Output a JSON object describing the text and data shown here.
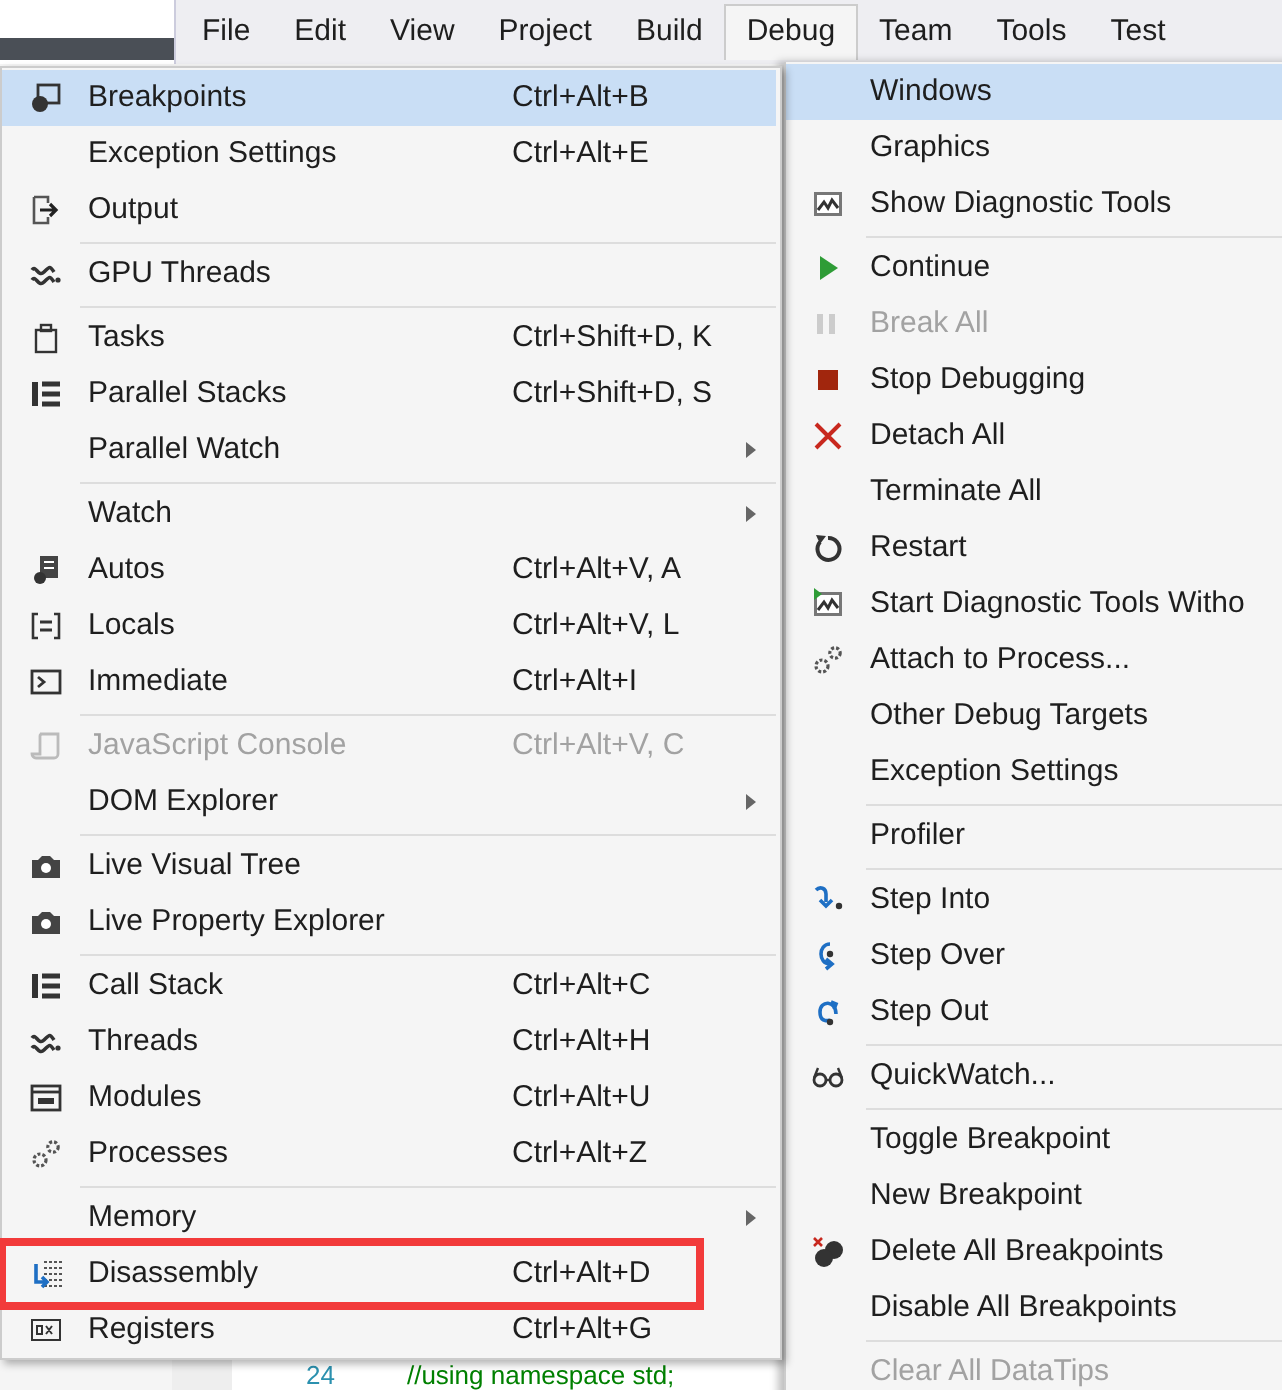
{
  "menu_bar": [
    {
      "label": "File",
      "selected": false
    },
    {
      "label": "Edit",
      "selected": false
    },
    {
      "label": "View",
      "selected": false
    },
    {
      "label": "Project",
      "selected": false
    },
    {
      "label": "Build",
      "selected": false
    },
    {
      "label": "Debug",
      "selected": true
    },
    {
      "label": "Team",
      "selected": false
    },
    {
      "label": "Tools",
      "selected": false
    },
    {
      "label": "Test",
      "selected": false
    }
  ],
  "windows_submenu": {
    "groups": [
      [
        {
          "label": "Breakpoints",
          "shortcut": "Ctrl+Alt+B",
          "selected": true,
          "disabled": false,
          "submenu": false,
          "highlighted": false
        },
        {
          "label": "Exception Settings",
          "shortcut": "Ctrl+Alt+E",
          "selected": false,
          "disabled": false,
          "submenu": false,
          "highlighted": false
        },
        {
          "label": "Output",
          "selected": false,
          "disabled": false,
          "submenu": false,
          "highlighted": false
        }
      ],
      [
        {
          "label": "GPU Threads",
          "selected": false,
          "disabled": false,
          "submenu": false,
          "highlighted": false
        }
      ],
      [
        {
          "label": "Tasks",
          "shortcut": "Ctrl+Shift+D, K",
          "selected": false,
          "disabled": false,
          "submenu": false,
          "highlighted": false
        },
        {
          "label": "Parallel Stacks",
          "shortcut": "Ctrl+Shift+D, S",
          "selected": false,
          "disabled": false,
          "submenu": false,
          "highlighted": false
        },
        {
          "label": "Parallel Watch",
          "selected": false,
          "disabled": false,
          "submenu": true,
          "highlighted": false
        }
      ],
      [
        {
          "label": "Watch",
          "selected": false,
          "disabled": false,
          "submenu": true,
          "highlighted": false
        },
        {
          "label": "Autos",
          "shortcut": "Ctrl+Alt+V, A",
          "selected": false,
          "disabled": false,
          "submenu": false,
          "highlighted": false
        },
        {
          "label": "Locals",
          "shortcut": "Ctrl+Alt+V, L",
          "selected": false,
          "disabled": false,
          "submenu": false,
          "highlighted": false
        },
        {
          "label": "Immediate",
          "shortcut": "Ctrl+Alt+I",
          "selected": false,
          "disabled": false,
          "submenu": false,
          "highlighted": false
        }
      ],
      [
        {
          "label": "JavaScript Console",
          "shortcut": "Ctrl+Alt+V, C",
          "selected": false,
          "disabled": true,
          "submenu": false,
          "highlighted": false
        },
        {
          "label": "DOM Explorer",
          "selected": false,
          "disabled": false,
          "submenu": true,
          "highlighted": false
        }
      ],
      [
        {
          "label": "Live Visual Tree",
          "selected": false,
          "disabled": false,
          "submenu": false,
          "highlighted": false
        },
        {
          "label": "Live Property Explorer",
          "selected": false,
          "disabled": false,
          "submenu": false,
          "highlighted": false
        }
      ],
      [
        {
          "label": "Call Stack",
          "shortcut": "Ctrl+Alt+C",
          "selected": false,
          "disabled": false,
          "submenu": false,
          "highlighted": false
        },
        {
          "label": "Threads",
          "shortcut": "Ctrl+Alt+H",
          "selected": false,
          "disabled": false,
          "submenu": false,
          "highlighted": false
        },
        {
          "label": "Modules",
          "shortcut": "Ctrl+Alt+U",
          "selected": false,
          "disabled": false,
          "submenu": false,
          "highlighted": false
        },
        {
          "label": "Processes",
          "shortcut": "Ctrl+Alt+Z",
          "selected": false,
          "disabled": false,
          "submenu": false,
          "highlighted": false
        }
      ],
      [
        {
          "label": "Memory",
          "selected": false,
          "disabled": false,
          "submenu": true,
          "highlighted": false
        },
        {
          "label": "Disassembly",
          "shortcut": "Ctrl+Alt+D",
          "selected": false,
          "disabled": false,
          "submenu": false,
          "highlighted": true
        },
        {
          "label": "Registers",
          "shortcut": "Ctrl+Alt+G",
          "selected": false,
          "disabled": false,
          "submenu": false,
          "highlighted": false
        }
      ]
    ]
  },
  "debug_menu": {
    "groups": [
      [
        {
          "label": "Windows",
          "selected": true,
          "disabled": false
        },
        {
          "label": "Graphics",
          "selected": false,
          "disabled": false
        },
        {
          "label": "Show Diagnostic Tools",
          "selected": false,
          "disabled": false
        }
      ],
      [
        {
          "label": "Continue",
          "selected": false,
          "disabled": false
        },
        {
          "label": "Break All",
          "selected": false,
          "disabled": true
        },
        {
          "label": "Stop Debugging",
          "selected": false,
          "disabled": false
        },
        {
          "label": "Detach All",
          "selected": false,
          "disabled": false
        },
        {
          "label": "Terminate All",
          "selected": false,
          "disabled": false
        },
        {
          "label": "Restart",
          "selected": false,
          "disabled": false
        },
        {
          "label": "Start Diagnostic Tools Witho",
          "selected": false,
          "disabled": false
        },
        {
          "label": "Attach to Process...",
          "selected": false,
          "disabled": false
        },
        {
          "label": "Other Debug Targets",
          "selected": false,
          "disabled": false
        },
        {
          "label": "Exception Settings",
          "selected": false,
          "disabled": false
        }
      ],
      [
        {
          "label": "Profiler",
          "selected": false,
          "disabled": false
        }
      ],
      [
        {
          "label": "Step Into",
          "selected": false,
          "disabled": false
        },
        {
          "label": "Step Over",
          "selected": false,
          "disabled": false
        },
        {
          "label": "Step Out",
          "selected": false,
          "disabled": false
        }
      ],
      [
        {
          "label": "QuickWatch...",
          "selected": false,
          "disabled": false
        }
      ],
      [
        {
          "label": "Toggle Breakpoint",
          "selected": false,
          "disabled": false
        },
        {
          "label": "New Breakpoint",
          "selected": false,
          "disabled": false
        },
        {
          "label": "Delete All Breakpoints",
          "selected": false,
          "disabled": false
        },
        {
          "label": "Disable All Breakpoints",
          "selected": false,
          "disabled": false
        }
      ],
      [
        {
          "label": "Clear All DataTips",
          "selected": false,
          "disabled": true
        }
      ]
    ]
  },
  "editor": {
    "line_number": "24",
    "code": "//using namespace std;"
  }
}
